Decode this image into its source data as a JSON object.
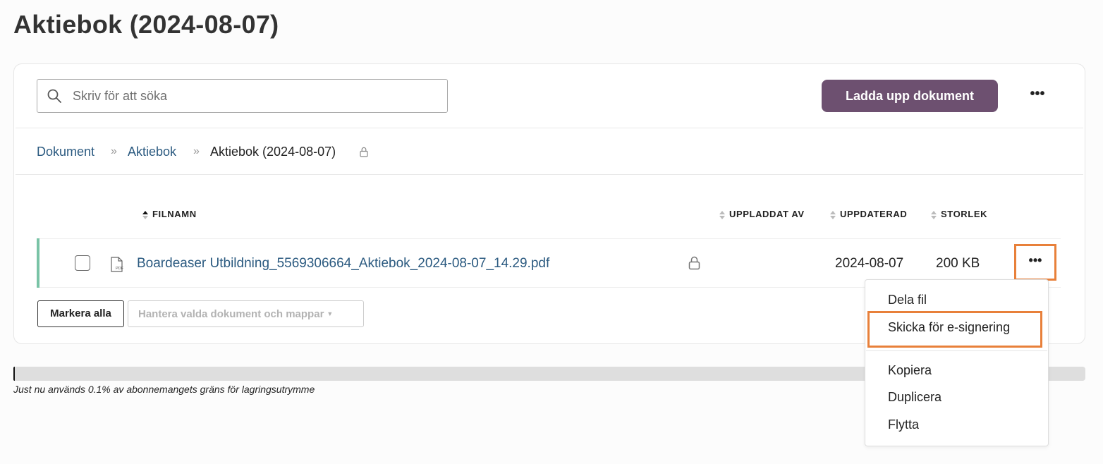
{
  "page": {
    "title": "Aktiebok (2024-08-07)"
  },
  "toolbar": {
    "search_placeholder": "Skriv för att söka",
    "upload_label": "Ladda upp dokument",
    "more_label": "•••"
  },
  "breadcrumb": {
    "items": [
      "Dokument",
      "Aktiebok"
    ],
    "separator": "»",
    "current": "Aktiebok (2024-08-07)"
  },
  "table": {
    "columns": [
      "FILNAMN",
      "UPPLADDAT AV",
      "UPPDATERAD",
      "STORLEK"
    ],
    "rows": [
      {
        "filename": "Boardeaser Utbildning_5569306664_Aktiebok_2024-08-07_14.29.pdf",
        "file_type": "PDF",
        "uploaded_by": "",
        "updated": "2024-08-07",
        "size": "200 KB",
        "locked": true,
        "more_label": "•••"
      }
    ]
  },
  "bulk": {
    "select_all_label": "Markera alla",
    "manage_label": "Hantera valda dokument och mappar",
    "manage_caret": "▼"
  },
  "storage": {
    "used_percent": 0.1,
    "text": "Just nu används 0.1% av abonnemangets gräns för lagringsutrymme"
  },
  "context_menu": {
    "items": [
      "Dela fil",
      "Skicka för e-signering",
      "Kopiera",
      "Duplicera",
      "Flytta"
    ]
  },
  "colors": {
    "primary_button": "#6d5070",
    "link": "#2b5a80",
    "accent_row": "#79c3a6",
    "highlight": "#e8803a"
  }
}
